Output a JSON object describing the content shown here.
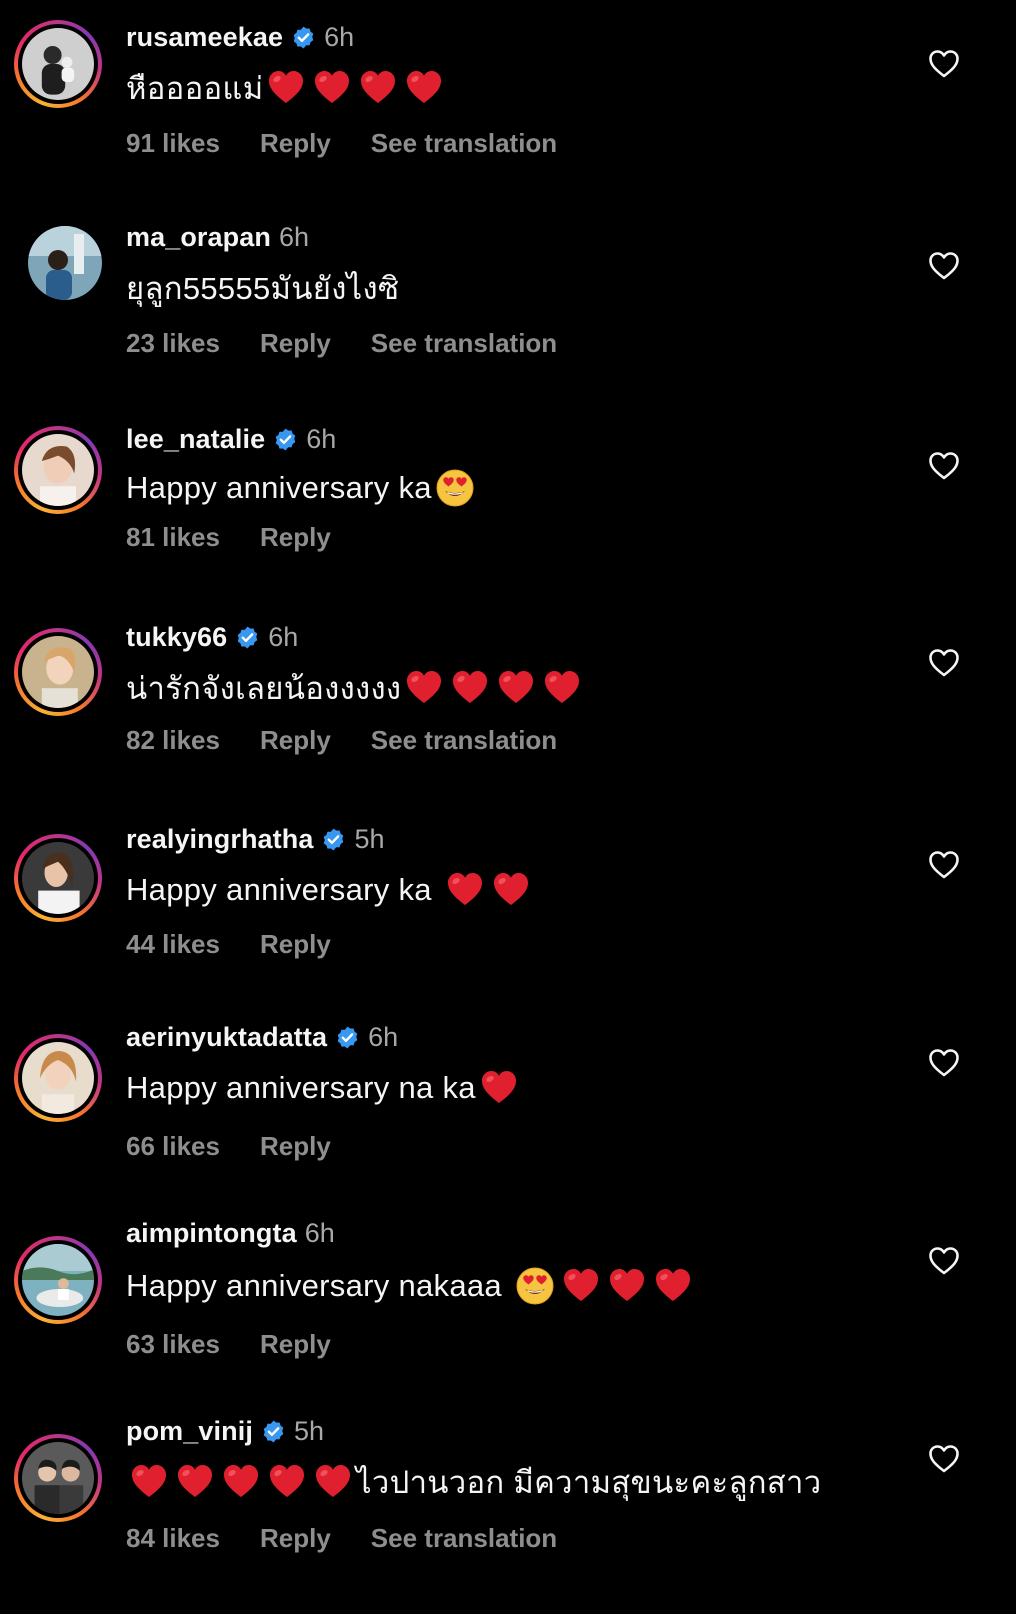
{
  "colors": {
    "background": "#000000",
    "username": "#f5f5f5",
    "meta": "#8e8e8e",
    "verified": "#3897f0",
    "heart_emoji": "#e0202f"
  },
  "comments": [
    {
      "username": "rusameekae",
      "verified": true,
      "time": "6h",
      "text": "หืออออแม่",
      "emoji_after": [
        "red-heart-emoji",
        "red-heart-emoji",
        "red-heart-emoji",
        "red-heart-emoji"
      ],
      "likes": "91 likes",
      "reply": "Reply",
      "translation": "See translation",
      "story_ring": true
    },
    {
      "username": "ma_orapan",
      "verified": false,
      "time": "6h",
      "text": "ยุลูก55555มันยังไงซิ",
      "emoji_after": [],
      "likes": "23 likes",
      "reply": "Reply",
      "translation": "See translation",
      "story_ring": false
    },
    {
      "username": "lee_natalie",
      "verified": true,
      "time": "6h",
      "text": "Happy anniversary ka",
      "emoji_after": [
        "heart-eyes-emoji"
      ],
      "likes": "81 likes",
      "reply": "Reply",
      "translation": "",
      "story_ring": true
    },
    {
      "username": "tukky66",
      "verified": true,
      "time": "6h",
      "text": "น่ารักจังเลยน้องงงงง",
      "emoji_after": [
        "red-heart-emoji",
        "red-heart-emoji",
        "red-heart-emoji",
        "red-heart-emoji"
      ],
      "likes": "82 likes",
      "reply": "Reply",
      "translation": "See translation",
      "story_ring": true
    },
    {
      "username": "realyingrhatha",
      "verified": true,
      "time": "5h",
      "text": "Happy anniversary ka",
      "emoji_after": [
        "red-heart-emoji",
        "red-heart-emoji"
      ],
      "likes": "44 likes",
      "reply": "Reply",
      "translation": "",
      "story_ring": true
    },
    {
      "username": "aerinyuktadatta",
      "verified": true,
      "time": "6h",
      "text": "Happy anniversary na ka",
      "emoji_after": [
        "red-heart-emoji"
      ],
      "likes": "66 likes",
      "reply": "Reply",
      "translation": "",
      "story_ring": true
    },
    {
      "username": "aimpintongta",
      "verified": false,
      "time": "6h",
      "text": "Happy anniversary nakaaa",
      "emoji_after": [
        "heart-eyes-emoji",
        "red-heart-emoji",
        "red-heart-emoji",
        "red-heart-emoji"
      ],
      "likes": "63 likes",
      "reply": "Reply",
      "translation": "",
      "story_ring": true
    },
    {
      "username": "pom_vinij",
      "verified": true,
      "time": "5h",
      "emoji_before": [
        "red-heart-emoji",
        "red-heart-emoji",
        "red-heart-emoji",
        "red-heart-emoji",
        "red-heart-emoji"
      ],
      "text": "ไวปานวอก มีความสุขนะคะลูกสาว",
      "likes": "84 likes",
      "reply": "Reply",
      "translation": "See translation",
      "story_ring": true
    }
  ]
}
